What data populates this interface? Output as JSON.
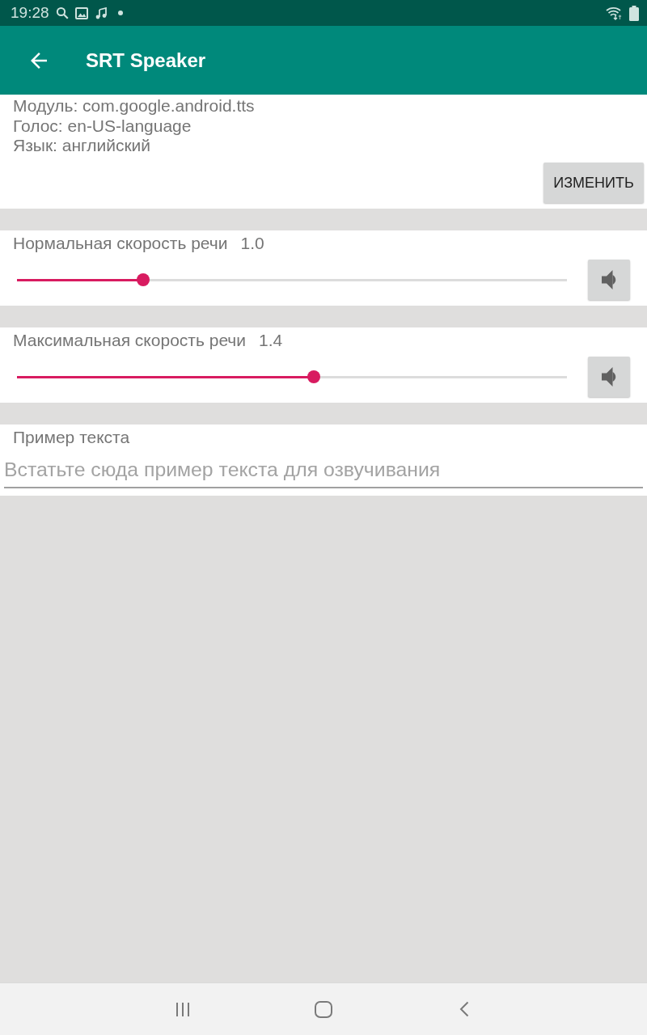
{
  "status_bar": {
    "time": "19:28"
  },
  "app_bar": {
    "title": "SRT Speaker"
  },
  "engine_info": {
    "lines": [
      "Модуль: com.google.android.tts",
      "Голос: en-US-language",
      "Язык: английский"
    ],
    "change_button": "ИЗМЕНИТЬ"
  },
  "speed_settings": [
    {
      "label": "Нормальная скорость речи",
      "reading": "1.0",
      "level": 0.23
    },
    {
      "label": "Максимальная скорость речи",
      "reading": "1.4",
      "level": 0.54
    }
  ],
  "sample_text": {
    "label": "Пример текста",
    "placeholder": "Встатьте сюда пример текста для озвучивания"
  }
}
